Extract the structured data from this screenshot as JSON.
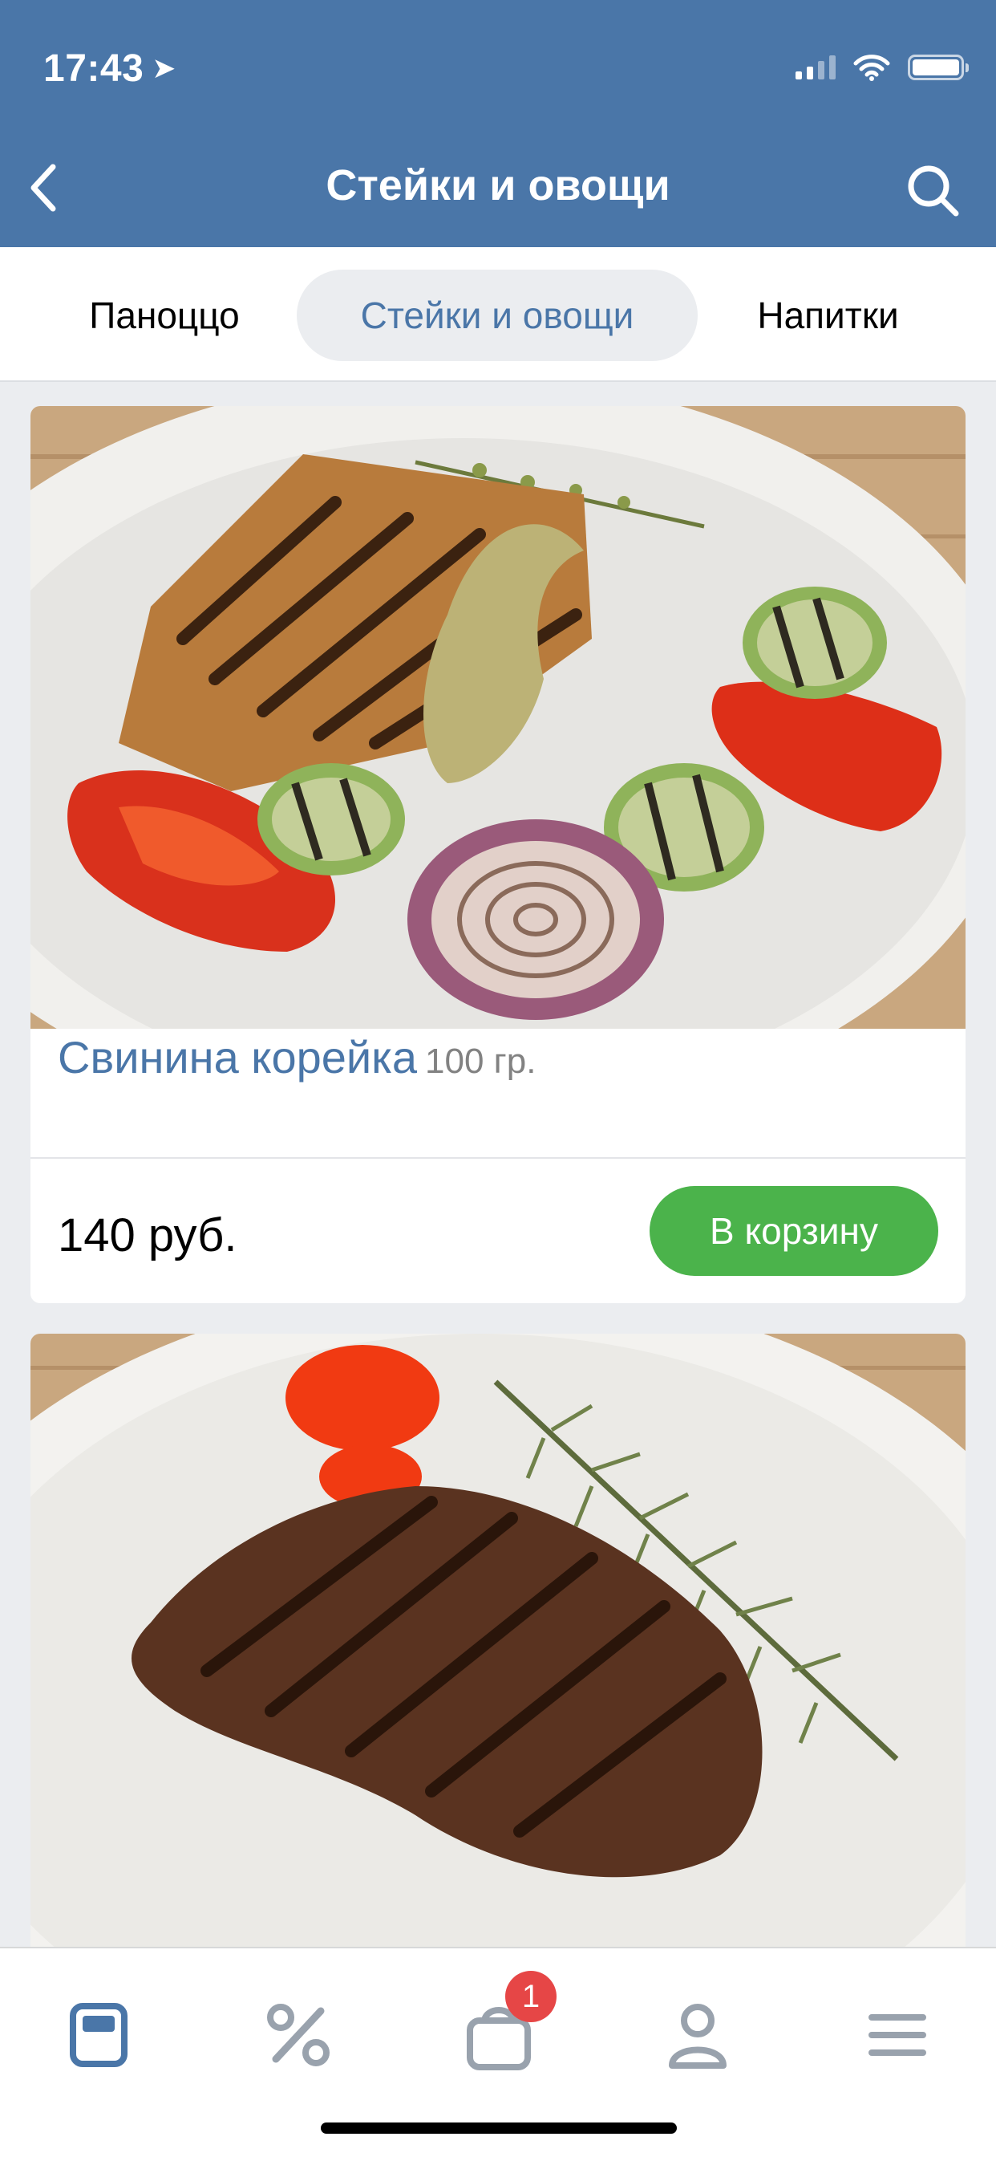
{
  "status_bar": {
    "time": "17:43"
  },
  "header": {
    "title": "Стейки и овощи",
    "back_icon": "chevron-left-icon",
    "search_icon": "search-icon"
  },
  "tabs": [
    {
      "label": "Паноццо",
      "active": false
    },
    {
      "label": "Стейки и овощи",
      "active": true
    },
    {
      "label": "Напитки",
      "active": false
    }
  ],
  "products": [
    {
      "name": "Свинина корейка",
      "weight": "100 гр.",
      "price": "140 руб.",
      "cart_label": "В корзину",
      "image": "grilled-pork-with-vegetables"
    },
    {
      "image": "grilled-beef-steak-with-rosemary"
    }
  ],
  "tabbar": {
    "items": [
      {
        "icon": "catalog-icon",
        "active": true
      },
      {
        "icon": "percent-icon",
        "active": false
      },
      {
        "icon": "cart-bag-icon",
        "active": false,
        "badge": "1"
      },
      {
        "icon": "profile-icon",
        "active": false
      },
      {
        "icon": "menu-icon",
        "active": false
      }
    ]
  },
  "colors": {
    "brand": "#4a76a8",
    "cart_button": "#4bb34b",
    "badge": "#e64646"
  }
}
